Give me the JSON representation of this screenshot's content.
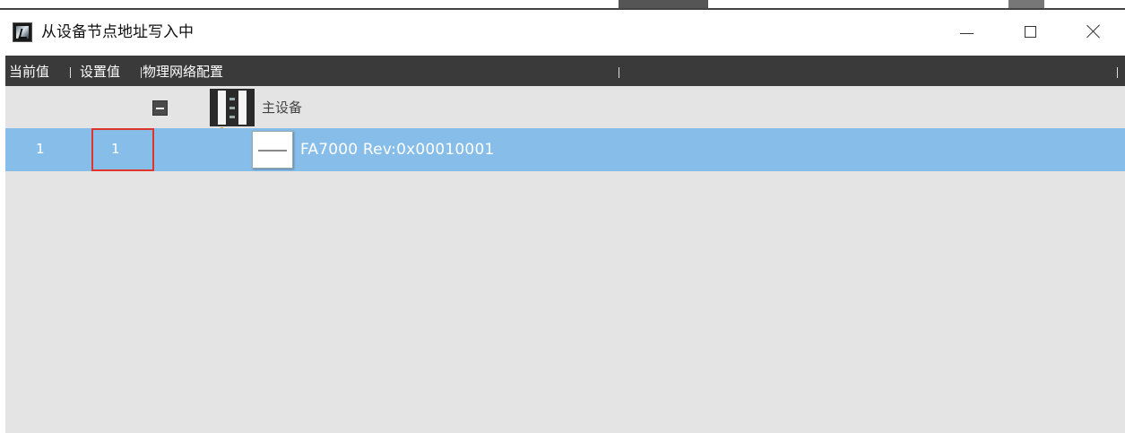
{
  "window": {
    "title": "从设备节点地址写入中",
    "controls": {
      "minimize": "minimize",
      "maximize": "maximize",
      "close": "close"
    }
  },
  "table": {
    "columns": {
      "current": "当前值",
      "set": "设置值",
      "physical": "物理网络配置"
    },
    "master": {
      "label": "主设备",
      "expanded": true
    },
    "rows": [
      {
        "current_value": "1",
        "set_value": "1",
        "device": "FA7000 Rev:0x00010001",
        "selected": true
      }
    ]
  },
  "colors": {
    "header_bg": "#3a3a3a",
    "selected_row": "#86bde9",
    "highlight_box": "#e0352b",
    "connector": "#f0a020",
    "body_bg": "#e4e4e4"
  }
}
